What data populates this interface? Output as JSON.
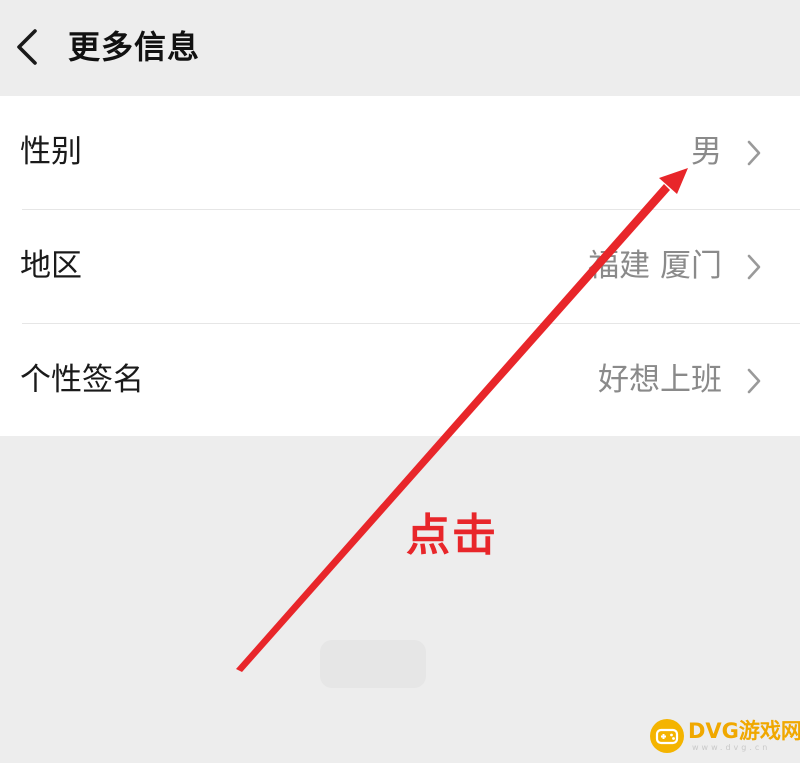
{
  "header": {
    "title": "更多信息",
    "back_icon": "chevron-left-icon"
  },
  "rows": [
    {
      "label": "性别",
      "value": "男",
      "icon": "chevron-right-icon"
    },
    {
      "label": "地区",
      "value": "福建 厦门",
      "icon": "chevron-right-icon"
    },
    {
      "label": "个性签名",
      "value": "好想上班",
      "icon": "chevron-right-icon"
    }
  ],
  "annotation": {
    "text": "点击",
    "color": "#e8262a"
  },
  "watermark": {
    "text": "DVG游戏网",
    "subtext": "www.dvg.cn",
    "logo_icon": "gamepad-icon",
    "color": "#f0a800"
  },
  "colors": {
    "background": "#ededed",
    "list_background": "#ffffff",
    "label_text": "#1a1a1a",
    "value_text": "#8a8a8a"
  }
}
